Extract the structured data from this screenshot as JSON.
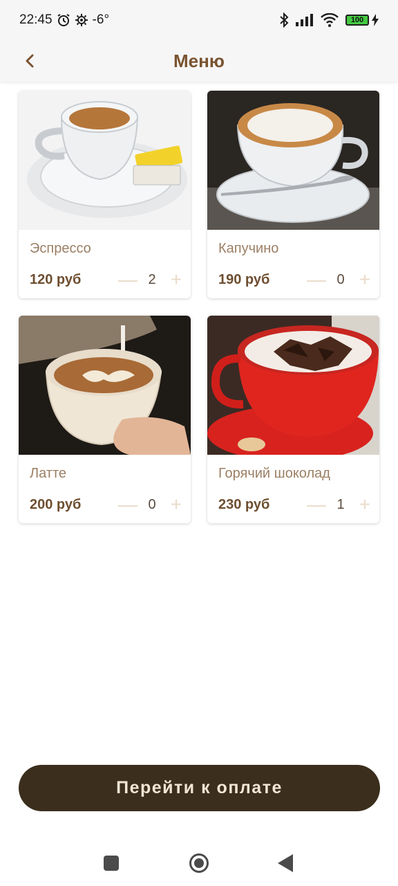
{
  "status_bar": {
    "time": "22:45",
    "temperature": "-6°",
    "battery": "100",
    "icons": [
      "alarm-icon",
      "settings-gear-icon",
      "bluetooth-icon",
      "signal-icon",
      "wifi-icon",
      "battery-icon",
      "charging-icon"
    ]
  },
  "header": {
    "title": "Меню",
    "back_icon": "chevron-left-icon"
  },
  "colors": {
    "accent_brown": "#7a5330",
    "name_text": "#9b7f64",
    "price_text": "#6e4e30",
    "stepper_symbols": "#eadbc8",
    "checkout_bg": "#3b2e1c",
    "checkout_text": "#f3e6d4"
  },
  "menu": {
    "items": [
      {
        "name": "Эспрессо",
        "price": "120 руб",
        "quantity": "2",
        "minus": "—",
        "plus": "+",
        "image": "espresso-photo"
      },
      {
        "name": "Капучино",
        "price": "190 руб",
        "quantity": "0",
        "minus": "—",
        "plus": "+",
        "image": "cappuccino-photo"
      },
      {
        "name": "Латте",
        "price": "200 руб",
        "quantity": "0",
        "minus": "—",
        "plus": "+",
        "image": "latte-photo"
      },
      {
        "name": "Горячий шоколад",
        "price": "230 руб",
        "quantity": "1",
        "minus": "—",
        "plus": "+",
        "image": "hot-chocolate-photo"
      }
    ]
  },
  "checkout": {
    "label": "Перейти к оплате"
  },
  "navbar": {
    "icons": [
      "recent-apps-icon",
      "home-icon",
      "back-triangle-icon"
    ]
  }
}
